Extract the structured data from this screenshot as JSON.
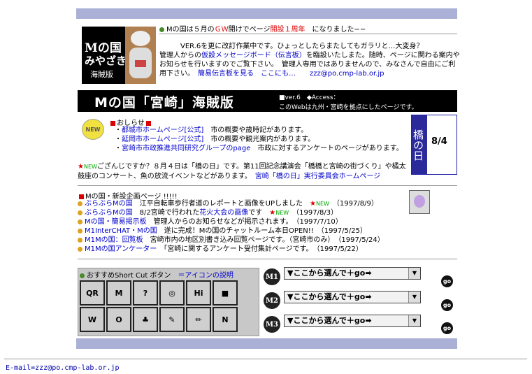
{
  "header": {
    "logo_line1": "Mの国",
    "logo_line2": "みやざき",
    "logo_line3": "海賊版",
    "announce_pre": "Mの国は５月の",
    "announce_gw": "ＧＷ",
    "announce_mid": "開けでページ",
    "announce_anniv": "開設１周年",
    "announce_post": "になりました−−",
    "intro_line1": "VER.6を更に改訂作業中です。ひょっとしたらまたしてもガラリと…大変身？",
    "intro_line2_pre": "管理人からの",
    "intro_link": "仮設メッセージボード（伝言板）",
    "intro_line2_post": "を臨設いたしまた。随時、ページに関わる案内や",
    "intro_line3": "お知らせを行いますのでご覧下さい。　管理人専用ではありませんので、みなさんで自由にご利",
    "intro_line4": "用下さい。",
    "board_link": "簡易伝言板を見る",
    "here_link": "ここにも…",
    "email_link": "zzz@po.cmp-lab.or.jp"
  },
  "banner": {
    "title": "Mの国「宮崎」海賊版",
    "ver": "■ver.6　◆Access：",
    "desc": "このWebは九州・宮崎を拠点にしたページです。"
  },
  "news": {
    "badge": "NEW",
    "heading": "おしらせ",
    "items": [
      {
        "link": "都城市ホームページ[公式]",
        "text": "市の概要や歳時記があります。"
      },
      {
        "link": "延岡市ホームページ[公式]",
        "text": "市の概要や観光案内があります。"
      },
      {
        "link": "宮崎市市政推進共同研究グループのpage",
        "text": "市政に対するアンケートのページがあります。"
      }
    ],
    "side_text": "橋の日",
    "side_date": "8/4"
  },
  "bridge": {
    "new_label": "NEW",
    "line1": "ござんじですか？８月４日は「橋の日」です。第11回記念講演会「橋橋と宮崎の街づくり」や橘太",
    "line2_pre": "鼓座のコンサート、魚の放流イベントなどがあります。",
    "line2_link": "宮崎「橋の日」実行委員会ホームページ"
  },
  "plans": {
    "heading": "Mの国・新設企画ページ !!!!!",
    "items": [
      {
        "link": "ぶらぶらMの国",
        "text": "江平自転車歩行者道のレポートと画像をUPしました",
        "new": "NEW",
        "date": "（1997/8/9）"
      },
      {
        "link": "ぶらぶらMの国",
        "text": "8/2宮崎で行われた",
        "link2": "花火大会の画像",
        "text2": "です",
        "new": "NEW",
        "date": "（1997/8/3）"
      },
      {
        "link": "Mの国・簡易掲示板",
        "text": "管理人からのお知らせなどが掲示されます。",
        "date": "（1997/7/10）"
      },
      {
        "link": "M1InterCHAT・Mの国",
        "text": "遂に完成！Mの国のチャットルーム本日OPEN!!",
        "date": "（1997/5/25）"
      },
      {
        "link": "M1Mの国：回覧板",
        "text": "宮崎市内の地区別書き込み回覧ページです。（宮崎市のみ）",
        "date": "（1997/5/24）"
      },
      {
        "link": "M1Mの国アンケーター",
        "text": "「宮崎に関するアンケート受付集計ページです。",
        "date": "（1997/5/22）"
      }
    ]
  },
  "shortcut": {
    "heading": "おすすめShort Cut ボタン",
    "link": "＝アイコンの説明",
    "buttons": [
      "QR",
      "M",
      "?",
      "◎",
      "Hi",
      "■",
      "W",
      "O",
      "♣",
      "✎",
      "✏",
      "N"
    ]
  },
  "selects": [
    {
      "badge": "M1",
      "value": "▼ここから選んで＋go➡"
    },
    {
      "badge": "M2",
      "value": "▼ここから選んで＋go➡"
    },
    {
      "badge": "M3",
      "value": "▼ここから選んで＋go➡"
    }
  ],
  "go_label": "go",
  "footer": {
    "email": "E-mail=zzz@po.cmp-lab.or.jp"
  }
}
